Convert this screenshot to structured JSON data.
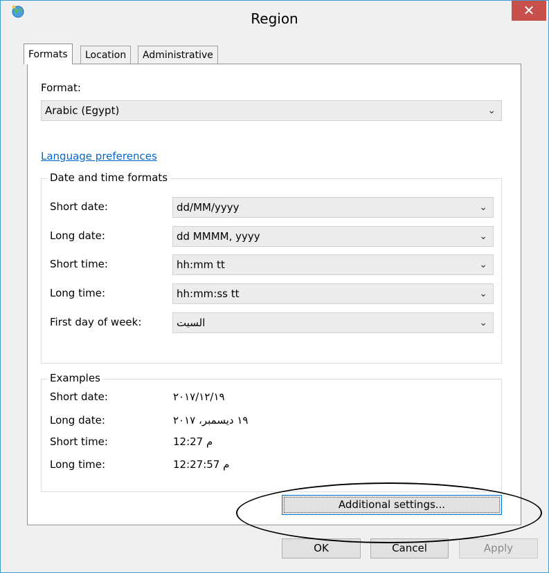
{
  "window": {
    "title": "Region",
    "close_glyph": "✕"
  },
  "tabs": [
    {
      "label": "Formats",
      "active": true
    },
    {
      "label": "Location",
      "active": false
    },
    {
      "label": "Administrative",
      "active": false
    }
  ],
  "formats": {
    "format_label": "Format:",
    "format_value": "Arabic (Egypt)",
    "language_link": "Language preferences",
    "datetime_group_title": "Date and time formats",
    "fields": [
      {
        "label": "Short date:",
        "value": "dd/MM/yyyy"
      },
      {
        "label": "Long date:",
        "value": "dd MMMM, yyyy"
      },
      {
        "label": "Short time:",
        "value": "hh:mm tt"
      },
      {
        "label": "Long time:",
        "value": "hh:mm:ss tt"
      },
      {
        "label": "First day of week:",
        "value": "السبت"
      }
    ],
    "examples_group_title": "Examples",
    "examples": [
      {
        "label": "Short date:",
        "value": "٢٠١٧/١٢/١٩"
      },
      {
        "label": "Long date:",
        "value": "١٩ ديسمبر، ٢٠١٧"
      },
      {
        "label": "Short time:",
        "value": "12:27 م"
      },
      {
        "label": "Long time:",
        "value": "12:27:57 م"
      }
    ],
    "additional_settings_label": "Additional settings..."
  },
  "footer": {
    "ok_label": "OK",
    "cancel_label": "Cancel",
    "apply_label": "Apply"
  },
  "colors": {
    "accent": "#0078d7",
    "close_button": "#c7504b",
    "link": "#0066cc"
  },
  "icons": {
    "title": "globe-icon",
    "dropdown": "chevron-down-icon",
    "close": "close-icon"
  }
}
